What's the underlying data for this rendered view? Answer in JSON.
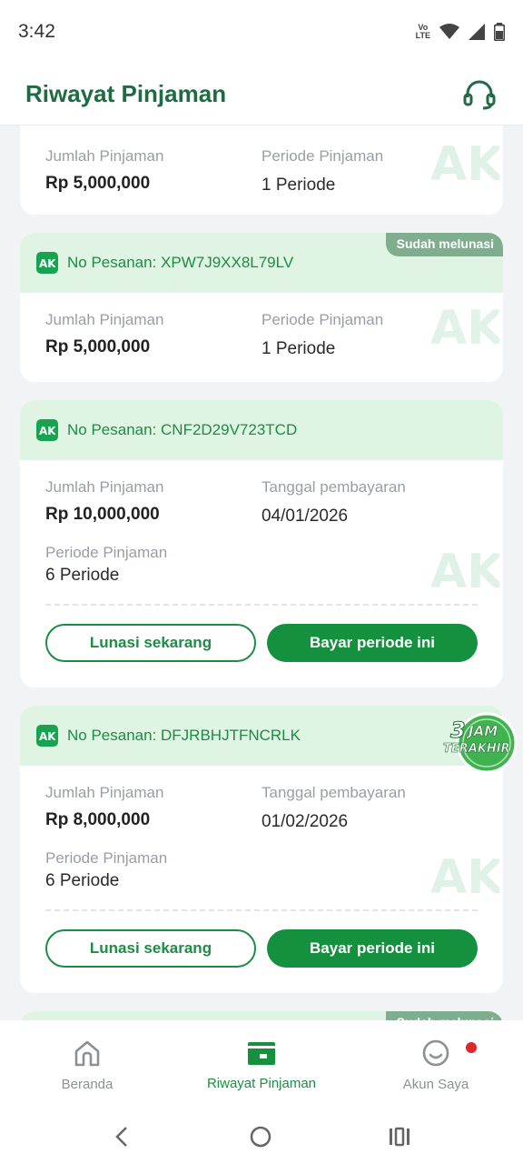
{
  "status_bar": {
    "time": "3:42",
    "network": "Vo LTE"
  },
  "header": {
    "title": "Riwayat Pinjaman"
  },
  "cards": [
    {
      "amount_label": "Jumlah Pinjaman",
      "amount": "Rp 5,000,000",
      "period_label": "Periode Pinjaman",
      "period": "1 Periode"
    },
    {
      "status": "Sudah melunasi",
      "order_no": "No Pesanan: XPW7J9XX8L79LV",
      "amount_label": "Jumlah Pinjaman",
      "amount": "Rp 5,000,000",
      "period_label": "Periode Pinjaman",
      "period": "1 Periode"
    },
    {
      "order_no": "No Pesanan: CNF2D29V723TCD",
      "amount_label": "Jumlah Pinjaman",
      "amount": "Rp 10,000,000",
      "date_label": "Tanggal pembayaran",
      "date": "04/01/2026",
      "period_label": "Periode Pinjaman",
      "period": "6 Periode",
      "btn_payoff": "Lunasi sekarang",
      "btn_pay": "Bayar periode ini"
    },
    {
      "order_no": "No Pesanan: DFJRBHJTFNCRLK",
      "badge": {
        "num": "3",
        "word1": "JAM",
        "word2": "TERAKHIR"
      },
      "amount_label": "Jumlah Pinjaman",
      "amount": "Rp 8,000,000",
      "date_label": "Tanggal pembayaran",
      "date": "01/02/2026",
      "period_label": "Periode Pinjaman",
      "period": "6 Periode",
      "btn_payoff": "Lunasi sekarang",
      "btn_pay": "Bayar periode ini"
    },
    {
      "status": "Sudah melunasi"
    }
  ],
  "bottom_nav": [
    {
      "label": "Beranda",
      "icon": "home-icon"
    },
    {
      "label": "Riwayat Pinjaman",
      "icon": "wallet-icon",
      "active": true
    },
    {
      "label": "Akun Saya",
      "icon": "smile-icon",
      "has_notification": true
    }
  ],
  "colors": {
    "brand_green": "#1b8d44",
    "header_green": "#1f6b43",
    "card_head_bg": "#dff4e3",
    "status_tag_bg": "#7fae8f",
    "notification_red": "#e0262b"
  }
}
